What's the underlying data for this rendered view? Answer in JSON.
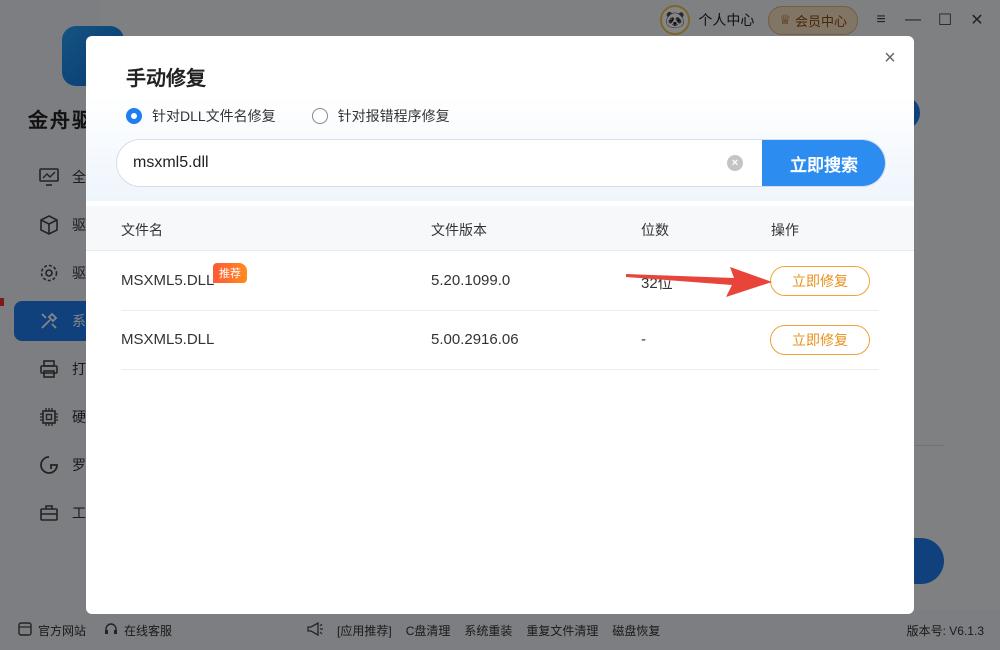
{
  "app": {
    "name": "金舟驱",
    "sidebar_items": [
      {
        "label": "全",
        "icon": "monitor-icon"
      },
      {
        "label": "驱",
        "icon": "cube-icon"
      },
      {
        "label": "驱",
        "icon": "gear-icon"
      },
      {
        "label": "系",
        "icon": "tools-icon"
      },
      {
        "label": "打",
        "icon": "printer-icon"
      },
      {
        "label": "硬",
        "icon": "chip-icon"
      },
      {
        "label": "罗",
        "icon": "gamepad-icon"
      },
      {
        "label": "工",
        "icon": "toolbox-icon"
      }
    ],
    "topbar": {
      "personal_center": "个人中心",
      "vip_center": "会员中心"
    },
    "footer": {
      "official_site": "官方网站",
      "online_service": "在线客服",
      "app_recommend": "[应用推荐]",
      "c_clean": "C盘清理",
      "reinstall": "系统重装",
      "dup_clean": "重复文件清理",
      "disk_recover": "磁盘恢复",
      "version": "版本号: V6.1.3"
    }
  },
  "modal": {
    "title": "手动修复",
    "close_symbol": "×",
    "radio_options": [
      {
        "label": "针对DLL文件名修复",
        "checked": true
      },
      {
        "label": "针对报错程序修复",
        "checked": false
      }
    ],
    "search": {
      "value": "msxml5.dll",
      "clear_symbol": "×",
      "button_label": "立即搜索"
    },
    "table": {
      "headers": [
        "文件名",
        "文件版本",
        "位数",
        "操作"
      ],
      "rows": [
        {
          "name": "MSXML5.DLL",
          "version": "5.20.1099.0",
          "bits": "32位",
          "badge": "推荐",
          "action": "立即修复"
        },
        {
          "name": "MSXML5.DLL",
          "version": "5.00.2916.06",
          "bits": "-",
          "badge": "",
          "action": "立即修复"
        }
      ]
    }
  },
  "colors": {
    "accent": "#2d8cf0",
    "fix_orange": "#f0a33a",
    "badge_red": "#ff5a36",
    "arrow_red": "#e8443a"
  }
}
